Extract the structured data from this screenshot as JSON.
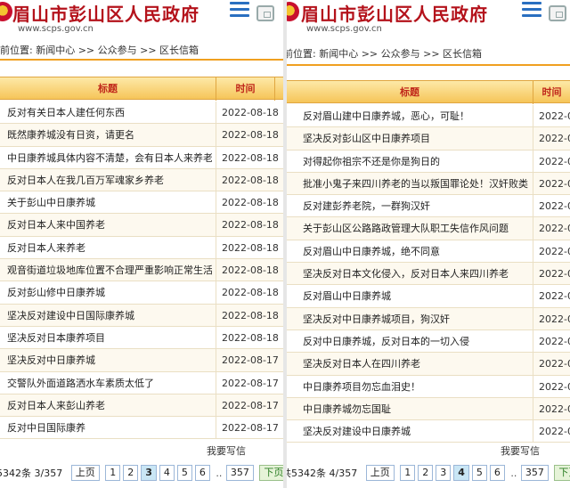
{
  "left": {
    "site_title": "眉山市彭山区人民政府",
    "site_url": "www.scps.gov.cn",
    "breadcrumb": "前位置: 新闻中心 >> 公众参与 >> 区长信箱",
    "table_header": {
      "title": "标题",
      "time": "时间"
    },
    "rows": [
      {
        "title": "反对有关日本人建任何东西",
        "date": "2022-08-18"
      },
      {
        "title": "既然康养城没有日资，请更名",
        "date": "2022-08-18"
      },
      {
        "title": "中日康养城具体内容不清楚，会有日本人来养老吗",
        "date": "2022-08-18"
      },
      {
        "title": "反对日本人在我几百万军魂家乡养老",
        "date": "2022-08-18"
      },
      {
        "title": "关于彭山中日康养城",
        "date": "2022-08-18"
      },
      {
        "title": "反对日本人来中国养老",
        "date": "2022-08-18"
      },
      {
        "title": "反对日本人来养老",
        "date": "2022-08-18"
      },
      {
        "title": "观音街道垃圾地库位置不合理严重影响正常生活",
        "date": "2022-08-18"
      },
      {
        "title": "反对彭山修中日康养城",
        "date": "2022-08-18"
      },
      {
        "title": "坚决反对建设中日国际康养城",
        "date": "2022-08-18"
      },
      {
        "title": "坚决反对日本康养项目",
        "date": "2022-08-18"
      },
      {
        "title": "坚决反对中日康养城",
        "date": "2022-08-17"
      },
      {
        "title": "交警队外面道路洒水车素质太低了",
        "date": "2022-08-17"
      },
      {
        "title": "反对日本人来彭山养老",
        "date": "2022-08-17"
      },
      {
        "title": "反对中日国际康养",
        "date": "2022-08-17"
      }
    ],
    "write_link": "我要写信",
    "pager": {
      "info": "5342条 3/357",
      "prev": "上页",
      "pages": [
        "1",
        "2",
        "3",
        "4",
        "5",
        "6"
      ],
      "current": "3",
      "ellipsis": "..",
      "last": "357",
      "next": "下页"
    }
  },
  "right": {
    "site_title": "眉山市彭山区人民政府",
    "site_url": "www.scps.gov.cn",
    "breadcrumb": "前位置: 新闻中心 >> 公众参与 >> 区长信箱",
    "table_header": {
      "title": "标题",
      "time": "时间"
    },
    "rows": [
      {
        "title": "反对眉山建中日康养城，恶心，可耻！",
        "date": "2022-08"
      },
      {
        "title": "坚决反对彭山区中日康养项目",
        "date": "2022-08"
      },
      {
        "title": "对得起你祖宗不还是你是狗日的",
        "date": "2022-08"
      },
      {
        "title": "批准小鬼子来四川养老的当以叛国罪论处！汉奸败类！",
        "date": "2022-08"
      },
      {
        "title": "反对建彭养老院，一群狗汉奸",
        "date": "2022-08"
      },
      {
        "title": "关于彭山区公路路政管理大队职工失信作风问题",
        "date": "2022-08"
      },
      {
        "title": "反对眉山中日康养城，绝不同意",
        "date": "2022-08"
      },
      {
        "title": "坚决反对日本文化侵入，反对日本人来四川养老",
        "date": "2022-08"
      },
      {
        "title": "反对眉山中日康养城",
        "date": "2022-08"
      },
      {
        "title": "坚决反对中日康养城项目，狗汉奸",
        "date": "2022-08"
      },
      {
        "title": "反对中日康养城，反对日本的一切入侵",
        "date": "2022-08"
      },
      {
        "title": "坚决反对日本人在四川养老",
        "date": "2022-08"
      },
      {
        "title": "中日康养项目勿忘血泪史！",
        "date": "2022-08"
      },
      {
        "title": "中日康养城勿忘国耻",
        "date": "2022-08"
      },
      {
        "title": "坚决反对建设中日康养城",
        "date": "2022-08"
      }
    ],
    "write_link": "我要写信",
    "pager": {
      "info": "共5342条 4/357",
      "prev": "上页",
      "pages": [
        "1",
        "2",
        "3",
        "4",
        "5",
        "6"
      ],
      "current": "4",
      "ellipsis": "..",
      "last": "357",
      "next": "下页"
    }
  },
  "colors": {
    "title_red": "#b4121b",
    "header_orange": "#f6c559",
    "link_blue": "#2a6fc0"
  }
}
